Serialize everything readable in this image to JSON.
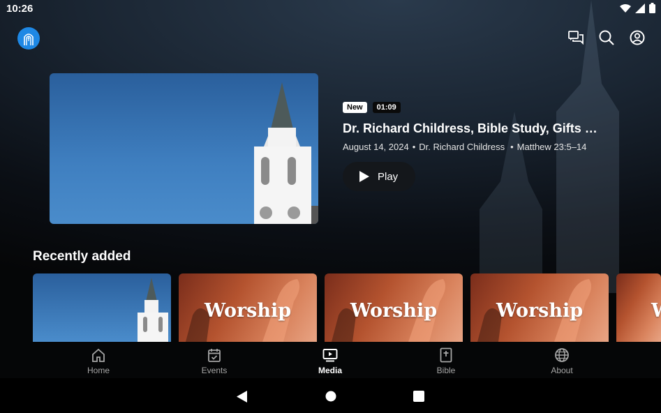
{
  "status": {
    "time": "10:26"
  },
  "hero": {
    "badge_new": "New",
    "duration": "01:09",
    "title": "Dr. Richard Childress, Bible Study, Gifts of the Spirit",
    "meta_date": "August 14, 2024",
    "meta_speaker": "Dr. Richard Childress",
    "meta_passage": "Matthew 23:5–14",
    "meta_sep": "•",
    "play_label": "Play"
  },
  "recent": {
    "title": "Recently added",
    "cards": [
      {
        "type": "church",
        "label": ""
      },
      {
        "type": "worship",
        "label": "Worship"
      },
      {
        "type": "worship",
        "label": "Worship"
      },
      {
        "type": "worship",
        "label": "Worship"
      },
      {
        "type": "worship",
        "label": "W"
      }
    ]
  },
  "nav": {
    "items": [
      {
        "label": "Home",
        "icon": "home-icon"
      },
      {
        "label": "Events",
        "icon": "calendar-icon"
      },
      {
        "label": "Media",
        "icon": "play-screen-icon"
      },
      {
        "label": "Bible",
        "icon": "bible-icon"
      },
      {
        "label": "About",
        "icon": "globe-icon"
      }
    ],
    "active": "Media"
  },
  "colors": {
    "accent": "#1e88e5",
    "background": "#050607"
  }
}
